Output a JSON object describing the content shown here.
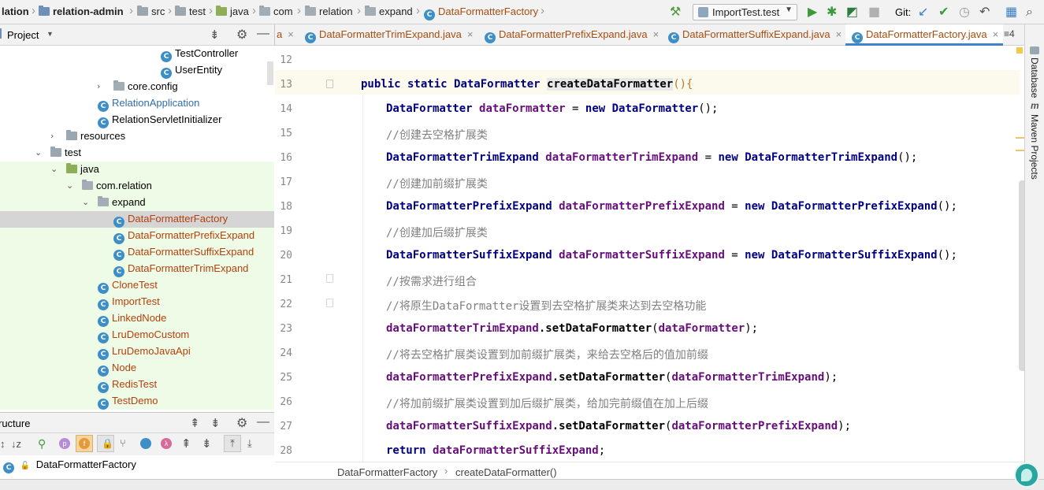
{
  "navbar": {
    "crumbs": [
      "lation",
      "relation-admin",
      "src",
      "test",
      "java",
      "com",
      "relation",
      "expand",
      "DataFormatterFactory"
    ],
    "run_config": "ImportTest.test",
    "git_label": "Git:"
  },
  "project_panel": {
    "title": "Project",
    "items": [
      {
        "label": "TestController",
        "kind": "class"
      },
      {
        "label": "UserEntity",
        "kind": "class"
      },
      {
        "label": "core.config",
        "kind": "package"
      },
      {
        "label": "RelationApplication",
        "kind": "class"
      },
      {
        "label": "RelationServletInitializer",
        "kind": "class"
      },
      {
        "label": "resources",
        "kind": "folder"
      },
      {
        "label": "test",
        "kind": "folder"
      },
      {
        "label": "java",
        "kind": "folder"
      },
      {
        "label": "com.relation",
        "kind": "package"
      },
      {
        "label": "expand",
        "kind": "package"
      },
      {
        "label": "DataFormatterFactory",
        "kind": "class"
      },
      {
        "label": "DataFormatterPrefixExpand",
        "kind": "class"
      },
      {
        "label": "DataFormatterSuffixExpand",
        "kind": "class"
      },
      {
        "label": "DataFormatterTrimExpand",
        "kind": "class"
      },
      {
        "label": "CloneTest",
        "kind": "class"
      },
      {
        "label": "ImportTest",
        "kind": "class"
      },
      {
        "label": "LinkedNode",
        "kind": "class"
      },
      {
        "label": "LruDemoCustom",
        "kind": "class"
      },
      {
        "label": "LruDemoJavaApi",
        "kind": "class"
      },
      {
        "label": "Node",
        "kind": "class"
      },
      {
        "label": "RedisTest",
        "kind": "class"
      },
      {
        "label": "TestDemo",
        "kind": "class"
      }
    ]
  },
  "structure_panel": {
    "title": "ructure",
    "root": "DataFormatterFactory"
  },
  "editor_tabs": [
    {
      "label": "a",
      "active": false
    },
    {
      "label": "DataFormatterTrimExpand.java",
      "active": false
    },
    {
      "label": "DataFormatterPrefixExpand.java",
      "active": false
    },
    {
      "label": "DataFormatterSuffixExpand.java",
      "active": false
    },
    {
      "label": "DataFormatterFactory.java",
      "active": true
    }
  ],
  "tab_overflow": "≡4",
  "editor": {
    "lines": [
      {
        "n": "12"
      },
      {
        "n": "13"
      },
      {
        "n": "14"
      },
      {
        "n": "15"
      },
      {
        "n": "16"
      },
      {
        "n": "17"
      },
      {
        "n": "18"
      },
      {
        "n": "19"
      },
      {
        "n": "20"
      },
      {
        "n": "21"
      },
      {
        "n": "22"
      },
      {
        "n": "23"
      },
      {
        "n": "24"
      },
      {
        "n": "25"
      },
      {
        "n": "26"
      },
      {
        "n": "27"
      },
      {
        "n": "28"
      }
    ],
    "code": {
      "l13_kw": "public static ",
      "l13_type": "DataFormatter ",
      "l13_method": "createDataFormatter",
      "l13_rest": "(){",
      "l14_type": "DataFormatter ",
      "l14_var": "dataFormatter",
      "l14_eq": " = ",
      "l14_new": "new ",
      "l14_cls": "DataFormatter",
      "l14_end": "();",
      "l15": "//创建去空格扩展类",
      "l16_type": "DataFormatterTrimExpand ",
      "l16_var": "dataFormatterTrimExpand",
      "l16_cls": "DataFormatterTrimExpand",
      "l17": "//创建加前缀扩展类",
      "l18_type": "DataFormatterPrefixExpand ",
      "l18_var": "dataFormatterPrefixExpand",
      "l18_cls": "DataFormatterPrefixExpand",
      "l19": "//创建加后缀扩展类",
      "l20_type": "DataFormatterSuffixExpand ",
      "l20_var": "dataFormatterSuffixExpand",
      "l20_cls": "DataFormatterSuffixExpand",
      "l21": "//按需求进行组合",
      "l22": "//将原生DataFormatter设置到去空格扩展类来达到去空格功能",
      "l23_var": "dataFormatterTrimExpand",
      "l23_m": ".setDataFormatter",
      "l23_arg": "dataFormatter",
      "l24": "//将去空格扩展类设置到加前缀扩展类，来给去空格后的值加前缀",
      "l25_var": "dataFormatterPrefixExpand",
      "l25_m": ".setDataFormatter",
      "l25_arg": "dataFormatterTrimExpand",
      "l26": "//将加前缀扩展类设置到加后缀扩展类，给加完前缀值在加上后缀",
      "l27_var": "dataFormatterSuffixExpand",
      "l27_m": ".setDataFormatter",
      "l27_arg": "dataFormatterPrefixExpand",
      "l28_kw": "return ",
      "l28_var": "dataFormatterSuffixExpand",
      "l28_end": ";",
      "eq": " = ",
      "new": "new ",
      "end": "();",
      "paren_open": "(",
      "paren_close": ");"
    }
  },
  "code_breadcrumb": [
    "DataFormatterFactory",
    "createDataFormatter()"
  ],
  "right_tools": [
    "Database",
    "Maven Projects"
  ],
  "colors": {
    "accent": "#4083c9",
    "test_green": "#eefbe6",
    "selection": "#d5d5d5",
    "keyword": "#000080",
    "variable": "#660e7a",
    "comment": "#808080"
  }
}
